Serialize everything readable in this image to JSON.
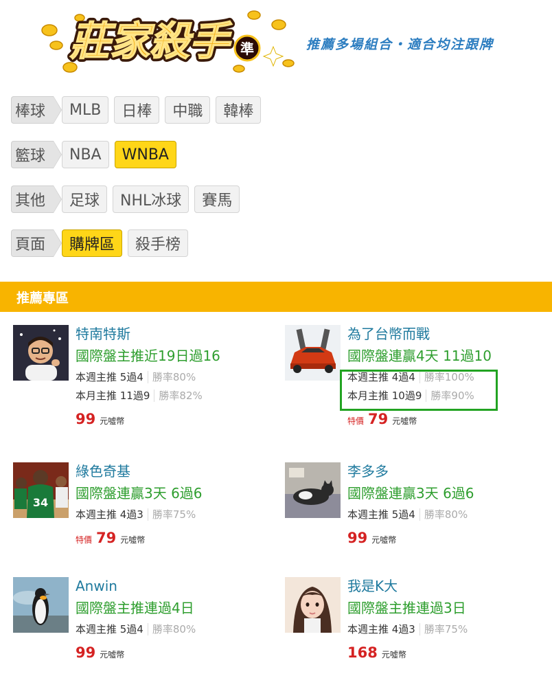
{
  "header": {
    "logo_text": "莊家殺手",
    "logo_badge": "準",
    "slogan": "推薦多場組合・適合均注跟牌"
  },
  "categories": [
    {
      "label": "棒球",
      "items": [
        {
          "text": "MLB",
          "active": false
        },
        {
          "text": "日棒",
          "active": false
        },
        {
          "text": "中職",
          "active": false
        },
        {
          "text": "韓棒",
          "active": false
        }
      ]
    },
    {
      "label": "籃球",
      "items": [
        {
          "text": "NBA",
          "active": false
        },
        {
          "text": "WNBA",
          "active": true
        }
      ]
    },
    {
      "label": "其他",
      "items": [
        {
          "text": "足球",
          "active": false
        },
        {
          "text": "NHL冰球",
          "active": false
        },
        {
          "text": "賽馬",
          "active": false
        }
      ]
    },
    {
      "label": "頁面",
      "items": [
        {
          "text": "購牌區",
          "active": true
        },
        {
          "text": "殺手榜",
          "active": false
        }
      ]
    }
  ],
  "section": {
    "title": "推薦專區"
  },
  "cards": [
    {
      "name": "特南特斯",
      "headline": "國際盤主推近19日過16",
      "week": "本週主推 5過4",
      "week_rate": "勝率80%",
      "month": "本月主推 11過9",
      "month_rate": "勝率82%",
      "promo": "",
      "price": "99",
      "unit": "元噓幣",
      "avatar": "memoji-avatar"
    },
    {
      "name": "為了台幣而戰",
      "headline": "國際盤連贏4天 11過10",
      "week": "本週主推 4過4",
      "week_rate": "勝率100%",
      "month": "本月主推 10過9",
      "month_rate": "勝率90%",
      "promo": "特價",
      "price": "79",
      "unit": "元噓幣",
      "avatar": "sports-car-avatar"
    },
    {
      "name": "綠色奇基",
      "headline": "國際盤連贏3天 6過6",
      "week": "本週主推 4過3",
      "week_rate": "勝率75%",
      "month": "",
      "month_rate": "",
      "promo": "特價",
      "price": "79",
      "unit": "元噓幣",
      "avatar": "basketball-player-avatar"
    },
    {
      "name": "李多多",
      "headline": "國際盤連贏3天 6過6",
      "week": "本週主推 5過4",
      "week_rate": "勝率80%",
      "month": "",
      "month_rate": "",
      "promo": "",
      "price": "99",
      "unit": "元噓幣",
      "avatar": "cat-avatar"
    },
    {
      "name": "Anwin",
      "headline": "國際盤主推連過4日",
      "week": "本週主推 5過4",
      "week_rate": "勝率80%",
      "month": "",
      "month_rate": "",
      "promo": "",
      "price": "99",
      "unit": "元噓幣",
      "avatar": "penguin-avatar"
    },
    {
      "name": "我是K大",
      "headline": "國際盤主推連過3日",
      "week": "本週主推 4過3",
      "week_rate": "勝率75%",
      "month": "",
      "month_rate": "",
      "promo": "",
      "price": "168",
      "unit": "元噓幣",
      "avatar": "girl-avatar"
    }
  ],
  "colors": {
    "accent_yellow": "#f8b400",
    "active_button": "#ffd618",
    "headline_green": "#2e9e2e",
    "name_blue": "#1f7a9e",
    "price_red": "#d52323",
    "highlight_green": "#22a322"
  }
}
